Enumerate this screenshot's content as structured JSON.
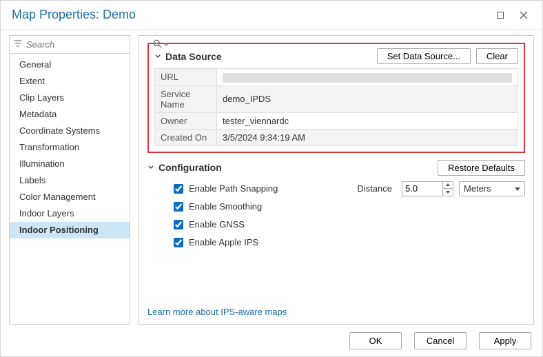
{
  "window": {
    "title": "Map Properties: Demo"
  },
  "search": {
    "placeholder": "Search"
  },
  "nav": {
    "items": [
      "General",
      "Extent",
      "Clip Layers",
      "Metadata",
      "Coordinate Systems",
      "Transformation",
      "Illumination",
      "Labels",
      "Color Management",
      "Indoor Layers",
      "Indoor Positioning"
    ],
    "active_index": 10
  },
  "data_source": {
    "title": "Data Source",
    "set_btn": "Set Data Source...",
    "clear_btn": "Clear",
    "rows": {
      "url_label": "URL",
      "url_value": "",
      "service_label": "Service Name",
      "service_value": "demo_IPDS",
      "owner_label": "Owner",
      "owner_value": "tester_viennardc",
      "created_label": "Created On",
      "created_value": "3/5/2024 9:34:19 AM"
    }
  },
  "configuration": {
    "title": "Configuration",
    "restore_btn": "Restore Defaults",
    "path_snapping": "Enable Path Snapping",
    "smoothing": "Enable Smoothing",
    "gnss": "Enable GNSS",
    "apple_ips": "Enable Apple IPS",
    "distance_label": "Distance",
    "distance_value": "5.0",
    "unit": "Meters"
  },
  "learn_more": "Learn more about IPS-aware maps",
  "footer": {
    "ok": "OK",
    "cancel": "Cancel",
    "apply": "Apply"
  }
}
